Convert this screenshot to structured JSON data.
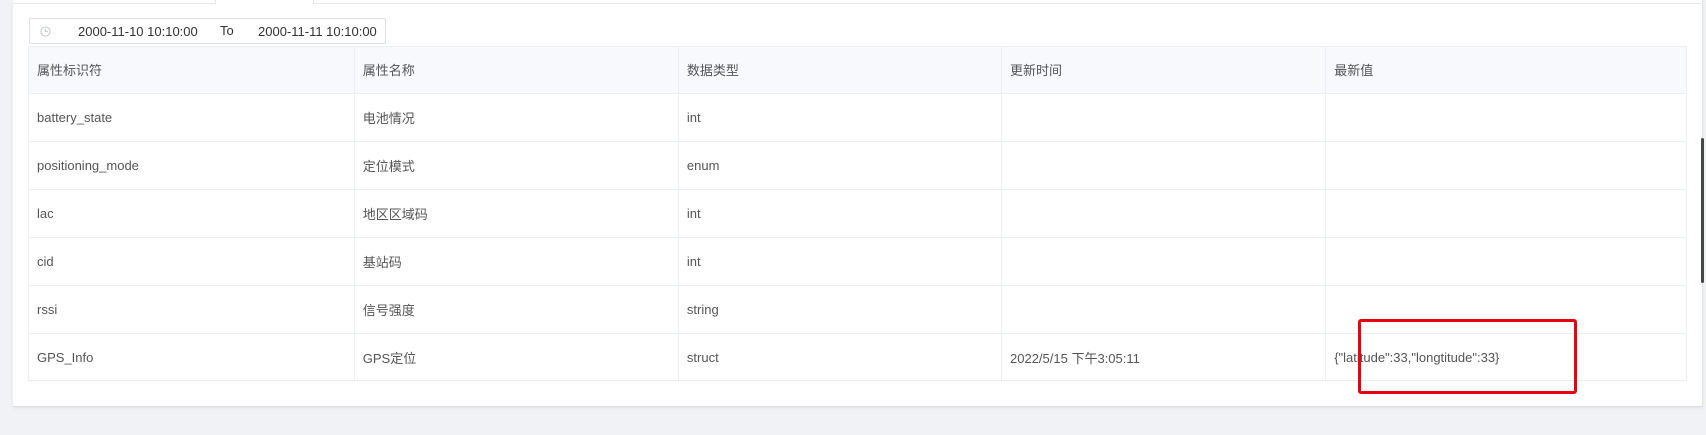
{
  "date_range": {
    "start": "2000-11-10 10:10:00",
    "separator": "To",
    "end": "2000-11-11 10:10:00"
  },
  "table": {
    "columns": [
      "属性标识符",
      "属性名称",
      "数据类型",
      "更新时间",
      "最新值"
    ],
    "rows": [
      {
        "identifier": "battery_state",
        "name": "电池情况",
        "type": "int",
        "updated": "",
        "value": ""
      },
      {
        "identifier": "positioning_mode",
        "name": "定位模式",
        "type": "enum",
        "updated": "",
        "value": ""
      },
      {
        "identifier": "lac",
        "name": "地区区域码",
        "type": "int",
        "updated": "",
        "value": ""
      },
      {
        "identifier": "cid",
        "name": "基站码",
        "type": "int",
        "updated": "",
        "value": ""
      },
      {
        "identifier": "rssi",
        "name": "信号强度",
        "type": "string",
        "updated": "",
        "value": ""
      },
      {
        "identifier": "GPS_Info",
        "name": "GPS定位",
        "type": "struct",
        "updated": "2022/5/15 下午3:05:11",
        "value": "{\"latitude\":33,\"longtitude\":33}"
      }
    ]
  },
  "colors": {
    "highlight": "#e60012",
    "header_bg": "#f7f9fc",
    "page_bg": "#f0f2f5"
  },
  "icons": {
    "date_range": "clock-icon"
  }
}
